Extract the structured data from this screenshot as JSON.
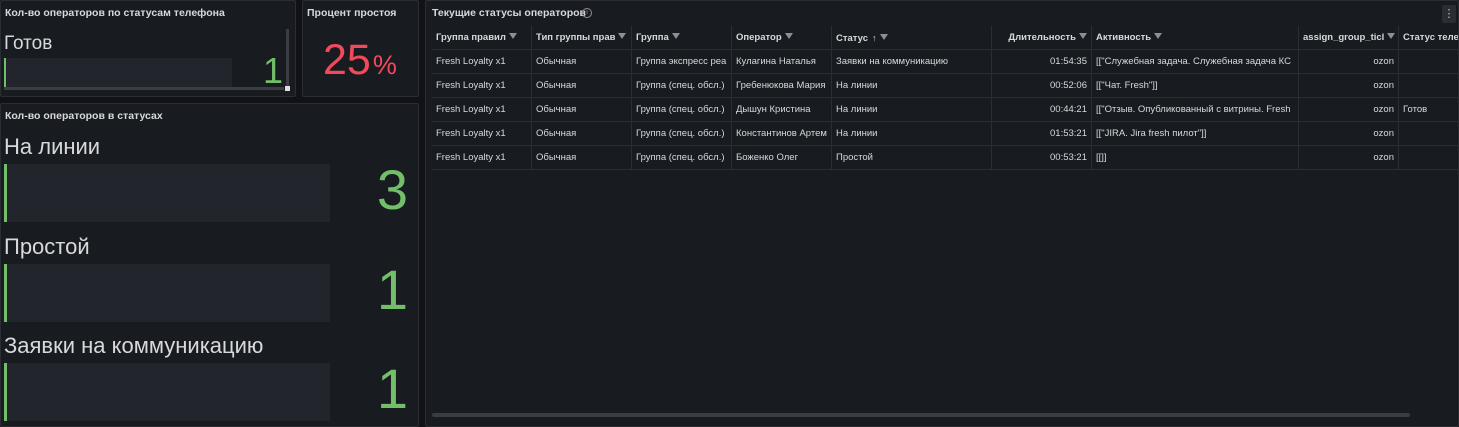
{
  "phone_status_panel": {
    "title": "Кол-во операторов по статусам телефона",
    "label": "Готов",
    "value": "1"
  },
  "idle_panel": {
    "title": "Процент простоя",
    "value": "25",
    "unit": "%"
  },
  "status_panel": {
    "title": "Кол-во операторов в статусах",
    "items": [
      {
        "label": "На линии",
        "value": "3"
      },
      {
        "label": "Простой",
        "value": "1"
      },
      {
        "label": "Заявки на коммуникацию",
        "value": "1"
      }
    ]
  },
  "table_panel": {
    "title": "Текущие статусы операторов",
    "info_icon": "info-icon",
    "menu_icon": "kebab-menu-icon",
    "columns": [
      "Группа правил",
      "Тип группы прав",
      "Группа",
      "Оператор",
      "Статус",
      "Длительность",
      "Активность",
      "assign_group_ticl",
      "Статус теле"
    ],
    "rows": [
      [
        "Fresh Loyalty x1",
        "Обычная",
        "Группа экспресс реа",
        "Кулагина Наталья",
        "Заявки на коммуникацию",
        "01:54:35",
        "[[\"Служебная задача. Служебная задача КС",
        "ozon",
        ""
      ],
      [
        "Fresh Loyalty x1",
        "Обычная",
        "Группа (спец. обсл.)",
        "Гребенюкова Мария",
        "На линии",
        "00:52:06",
        "[[\"Чат. Fresh\"]]",
        "ozon",
        ""
      ],
      [
        "Fresh Loyalty x1",
        "Обычная",
        "Группа (спец. обсл.)",
        "Дышун Кристина",
        "На линии",
        "00:44:21",
        "[[\"Отзыв. Опубликованный с витрины. Fresh",
        "ozon",
        "Готов"
      ],
      [
        "Fresh Loyalty x1",
        "Обычная",
        "Группа (спец. обсл.)",
        "Константинов Артем",
        "На линии",
        "01:53:21",
        "[[\"JIRA. Jira fresh пилот\"]]",
        "ozon",
        ""
      ],
      [
        "Fresh Loyalty x1",
        "Обычная",
        "Группа (спец. обсл.)",
        "Боженко Олег",
        "Простой",
        "00:53:21",
        "[[]]",
        "ozon",
        ""
      ]
    ]
  },
  "colors": {
    "background": "#111217",
    "panel": "#181b1f",
    "green": "#73bf69",
    "red": "#f2495c"
  }
}
